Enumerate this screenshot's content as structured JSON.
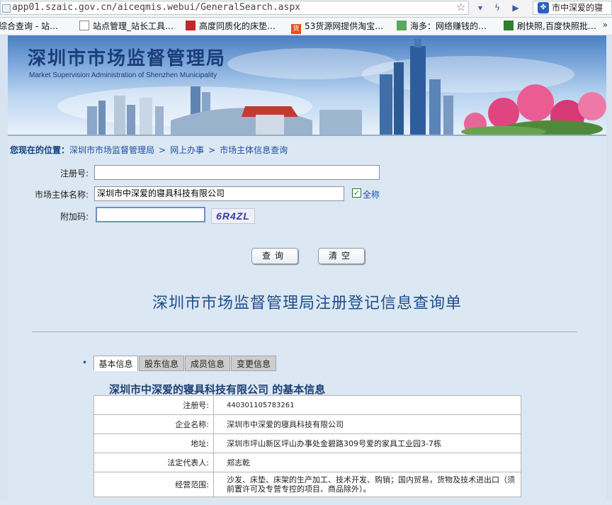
{
  "browser": {
    "url": "app01.szaic.gov.cn/aiceqmis.webui/GeneralSearch.aspx",
    "search_text": "市中深爱的寝",
    "bookmarks": [
      {
        "label": "综合查询 - 站…"
      },
      {
        "label": "站点管理_站长工具…"
      },
      {
        "label": "高度同质化的床垫…"
      },
      {
        "label": "53货源网提供淘宝…"
      },
      {
        "label": "海多：网络赚钱的…"
      },
      {
        "label": "刷快照,百度快照批…"
      }
    ],
    "more_arrow": "»"
  },
  "banner": {
    "title": "深圳市市场监督管理局",
    "subtitle": "Market Supervision Administration of Shenzhen Municipality"
  },
  "breadcrumb": {
    "prefix": "您现在的位置：",
    "items": [
      "深圳市市场监督管理局",
      "网上办事",
      "市场主体信息查询"
    ],
    "separator": ">"
  },
  "form": {
    "reg_no_label": "注册号:",
    "reg_no_value": "",
    "name_label": "市场主体名称:",
    "name_value": "深圳市中深爱的寝具科技有限公司",
    "fullname_label": "全称",
    "fullname_checked": "✓",
    "code_label": "附加码:",
    "code_value": "",
    "captcha": "6R4ZL",
    "query_button": "查询",
    "clear_button": "清空"
  },
  "report": {
    "title": "深圳市市场监督管理局注册登记信息查询单",
    "bullet": "•",
    "tabs": [
      "基本信息",
      "股东信息",
      "成员信息",
      "变更信息"
    ],
    "table_title": "深圳市中深爱的寝具科技有限公司 的基本信息",
    "rows": [
      {
        "key": "注册号:",
        "value": "440301105783261"
      },
      {
        "key": "企业名称:",
        "value": "深圳市中深爱的寝具科技有限公司"
      },
      {
        "key": "地址:",
        "value": "深圳市坪山新区坪山办事处金碧路309号爱的家具工业园3-7栋"
      },
      {
        "key": "法定代表人:",
        "value": "郑志乾"
      },
      {
        "key": "经营范围:",
        "value": "沙发、床垫、床架的生产加工、技术开发、购销；国内贸易，货物及技术进出口（须前置许可及专营专控的项目、商品除外）。"
      }
    ]
  }
}
